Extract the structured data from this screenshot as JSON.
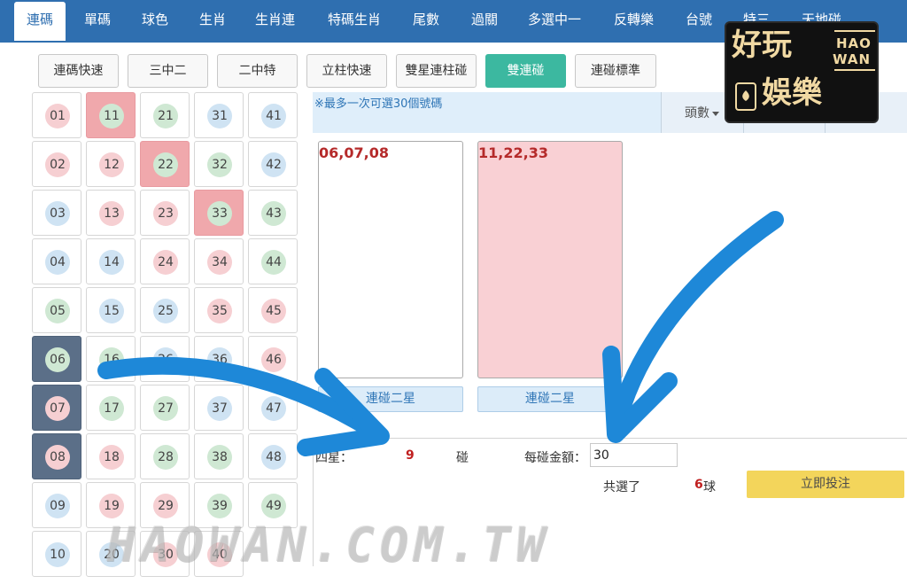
{
  "topnav": {
    "items": [
      "連碼",
      "單碼",
      "球色",
      "生肖",
      "生肖連",
      "特碼生肖",
      "尾數",
      "過關",
      "多選中一",
      "反轉樂",
      "台號",
      "特三",
      "天地碰"
    ],
    "active": "連碼"
  },
  "subtabs": [
    "連碼快速",
    "三中二",
    "二中特",
    "立柱快速",
    "雙星連柱碰",
    "雙連碰",
    "連碰標準"
  ],
  "subtab_active": "雙連碰",
  "balls": {
    "columns": [
      [
        "01",
        "02",
        "03",
        "04",
        "05",
        "06",
        "07",
        "08",
        "09",
        "10"
      ],
      [
        "11",
        "12",
        "13",
        "14",
        "15",
        "16",
        "17",
        "18",
        "19",
        "20"
      ],
      [
        "21",
        "22",
        "23",
        "24",
        "25",
        "26",
        "27",
        "28",
        "29",
        "30"
      ],
      [
        "31",
        "32",
        "33",
        "34",
        "35",
        "36",
        "37",
        "38",
        "39",
        "40"
      ],
      [
        "41",
        "42",
        "43",
        "44",
        "45",
        "46",
        "47",
        "48",
        "49"
      ]
    ],
    "selected_pink": [
      "11",
      "22",
      "33"
    ],
    "selected_dark": [
      "06",
      "07",
      "08"
    ],
    "colors": {
      "red": "#f6cfd2",
      "blue": "#cfe3f3",
      "green": "#cfe8d3",
      "pink_cell": "#f0a8ac",
      "dark_cell": "#5b6f88"
    }
  },
  "notice": "※最多一次可選30個號碼",
  "header_filter": {
    "label": "頭數"
  },
  "cards": [
    {
      "combo": "06,07,08",
      "button": "連碰二星",
      "bg": "#ffffff"
    },
    {
      "combo": "11,22,33",
      "button": "連碰二星",
      "bg": "#f9d0d4"
    }
  ],
  "summary": {
    "type_label": "四星：",
    "count": "9",
    "count_unit": "碰",
    "amount_label": "每碰金額：",
    "amount_value": "30",
    "total_prefix": "共選了",
    "total_count": "6",
    "total_unit": "球",
    "submit": "立即投注"
  },
  "logo": {
    "main_top": "好玩",
    "main_bottom": "娛樂",
    "en_top": "HAO",
    "en_bottom": "WAN"
  },
  "watermark": "HAOWAN.COM.TW",
  "accent_colors": {
    "nav": "#2f6fb0",
    "active_tab": "#3cb8a0",
    "arrow": "#1e88d8",
    "submit": "#f3d55b"
  }
}
